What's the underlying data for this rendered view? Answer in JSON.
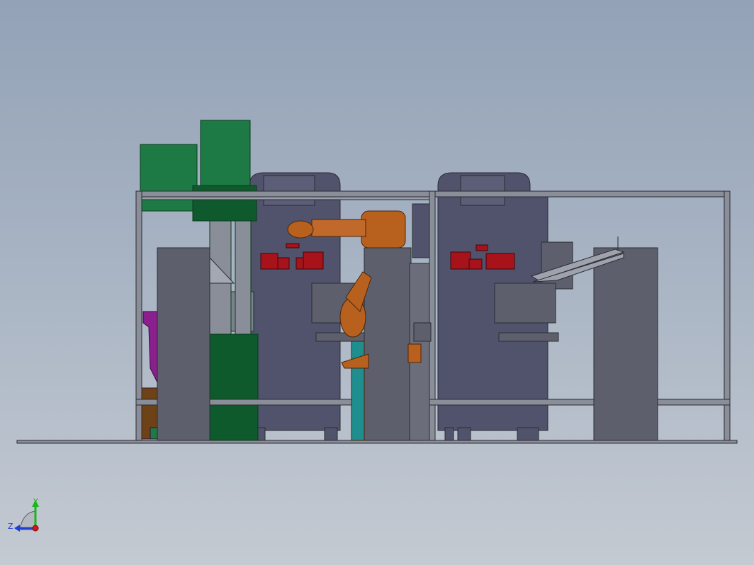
{
  "viewport": {
    "background_top": "#93a2b7",
    "background_bottom": "#c4cad2"
  },
  "model": {
    "colors": {
      "machine_body": "#50536b",
      "frame_steel": "#8a8e98",
      "panel_gray": "#5d606c",
      "hopper_green": "#1e7a45",
      "hopper_green_dark": "#0f5a2c",
      "robot_orange": "#b8611f",
      "gripper_red": "#a8121a",
      "pedestal_teal": "#1e8e8e",
      "chute_purple": "#8a1f8e",
      "stand_brown": "#6d4217"
    }
  },
  "triad": {
    "y_label": "Y",
    "z_label": "Z",
    "y_color": "#1db41d",
    "z_color": "#1f3fd6",
    "x_color": "#d01818"
  }
}
